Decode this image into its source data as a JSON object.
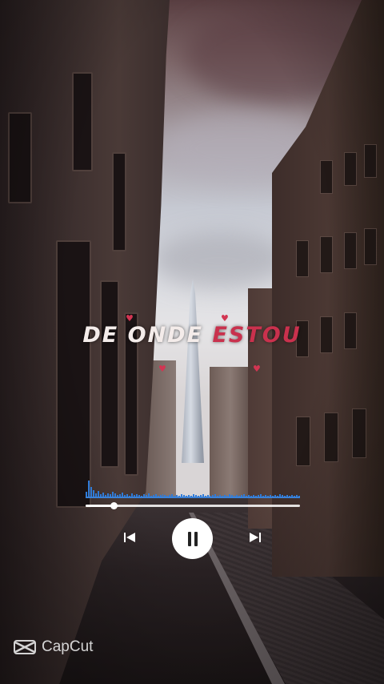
{
  "lyric": {
    "line_white": "DE ONDE",
    "line_accent": "ESTOU",
    "accent_color": "#c9314d"
  },
  "player": {
    "progress_fraction": 0.13,
    "waveform_color": "#2f7bd8",
    "prev_icon": "skip-previous-icon",
    "play_pause_icon": "pause-icon",
    "next_icon": "skip-next-icon"
  },
  "watermark": {
    "brand": "CapCut",
    "icon": "capcut-logo-icon"
  }
}
